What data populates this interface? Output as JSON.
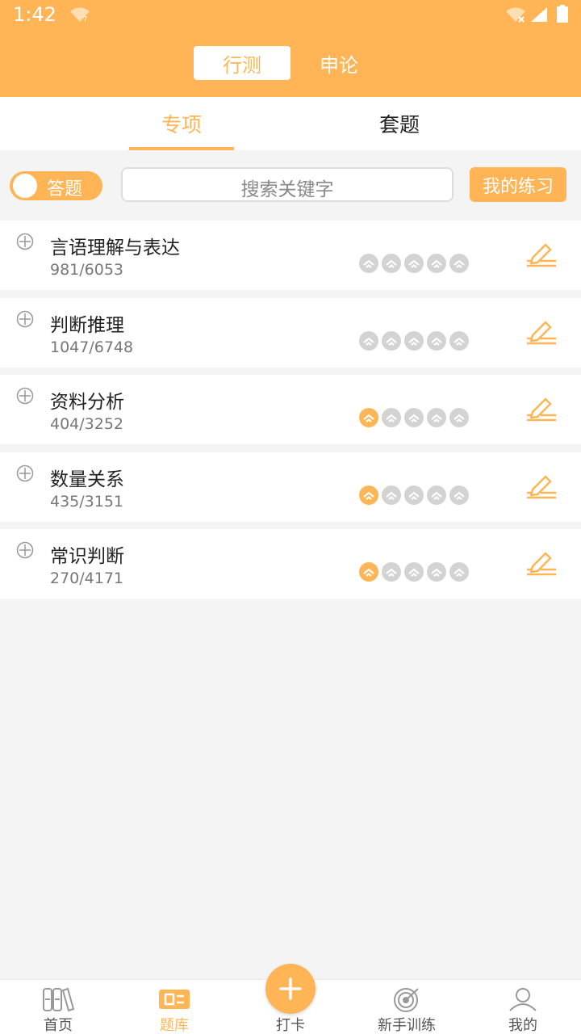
{
  "status": {
    "time": "1:42"
  },
  "header": {
    "segments": [
      {
        "label": "行测",
        "active": true
      },
      {
        "label": "申论",
        "active": false
      }
    ]
  },
  "tabs": [
    {
      "label": "专项",
      "active": true
    },
    {
      "label": "套题",
      "active": false
    }
  ],
  "toolbar": {
    "toggle_label": "答题",
    "search_placeholder": "搜索关键字",
    "my_practice_label": "我的练习"
  },
  "categories": [
    {
      "title": "言语理解与表达",
      "count": "981/6053",
      "level": 0
    },
    {
      "title": "判断推理",
      "count": "1047/6748",
      "level": 0
    },
    {
      "title": "资料分析",
      "count": "404/3252",
      "level": 1
    },
    {
      "title": "数量关系",
      "count": "435/3151",
      "level": 1
    },
    {
      "title": "常识判断",
      "count": "270/4171",
      "level": 1
    }
  ],
  "level_max": 5,
  "tabbar": {
    "items": [
      {
        "label": "首页",
        "icon": "home-books-icon",
        "active": false
      },
      {
        "label": "题库",
        "icon": "question-bank-icon",
        "active": true
      },
      {
        "label": "打卡",
        "icon": "plus-icon",
        "active": false
      },
      {
        "label": "新手训练",
        "icon": "target-icon",
        "active": false
      },
      {
        "label": "我的",
        "icon": "person-icon",
        "active": false
      }
    ]
  },
  "colors": {
    "accent": "#FFB555",
    "inactive_level": "#d3d3d3"
  }
}
